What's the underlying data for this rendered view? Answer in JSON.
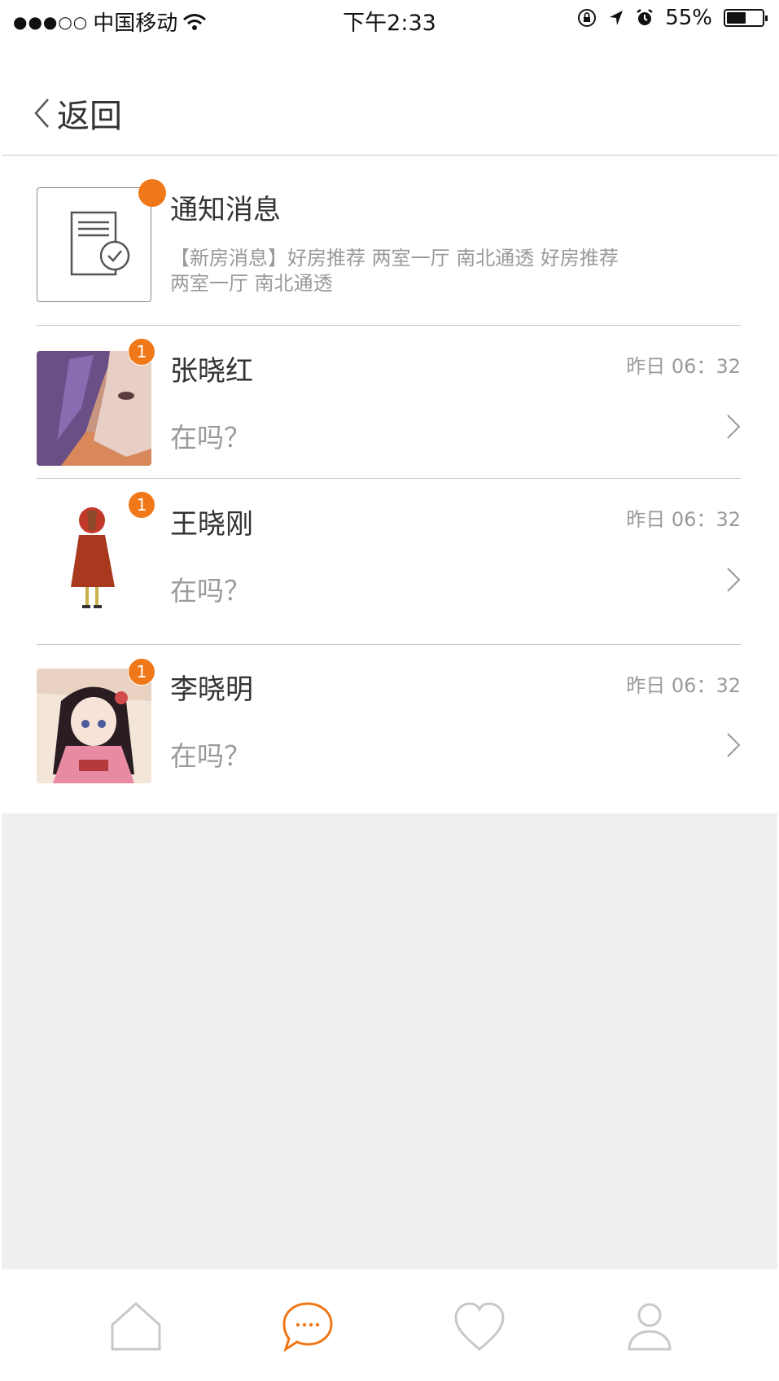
{
  "status_bar": {
    "signal": "●●●○○",
    "carrier": "中国移动",
    "time": "下午2:33",
    "battery_percent": "55%",
    "battery_level": 0.55
  },
  "nav": {
    "back_label": "返回"
  },
  "notice": {
    "title": "通知消息",
    "text": "【新房消息】好房推荐 两室一厅 南北通透 好房推荐 两室一厅 南北通透"
  },
  "conversations": [
    {
      "name": "张晓红",
      "time": "昨日  06：32",
      "preview": "在吗？",
      "unread": "1"
    },
    {
      "name": "王晓刚",
      "time": "昨日  06：32",
      "preview": "在吗？",
      "unread": "1"
    },
    {
      "name": "李晓明",
      "time": "昨日  06：32",
      "preview": "在吗？",
      "unread": "1"
    }
  ],
  "tab_bar": {
    "items": [
      {
        "icon": "home-icon",
        "active": false
      },
      {
        "icon": "message-icon",
        "active": true
      },
      {
        "icon": "heart-icon",
        "active": false
      },
      {
        "icon": "user-icon",
        "active": false
      }
    ],
    "active_color": "#f07818",
    "inactive_color": "#c8c8c8"
  },
  "colors": {
    "accent": "#f07818",
    "divider": "#c8c8c8",
    "background": "#efefef"
  }
}
